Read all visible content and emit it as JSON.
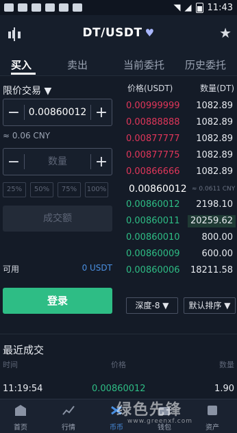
{
  "status_bar": {
    "time": "11:43"
  },
  "header": {
    "pair": "DT/USDT",
    "fav_icon": "heart-icon"
  },
  "tabs": [
    "买入",
    "卖出",
    "当前委托",
    "历史委托"
  ],
  "order_form": {
    "order_type": "限价交易 ▼",
    "price": "0.00860012",
    "approx": "≈ 0.06 CNY",
    "quantity_placeholder": "数量",
    "percentages": [
      "25%",
      "50%",
      "75%",
      "100%"
    ],
    "amount_placeholder": "成交额",
    "available_label": "可用",
    "available_value": "0 USDT",
    "buy_button": "登录"
  },
  "order_book": {
    "price_header": "价格(USDT)",
    "qty_header": "数量(DT)",
    "asks": [
      {
        "price": "0.00999999",
        "qty": "1082.89"
      },
      {
        "price": "0.00888888",
        "qty": "1082.89"
      },
      {
        "price": "0.00877777",
        "qty": "1082.89"
      },
      {
        "price": "0.00877775",
        "qty": "1082.89"
      },
      {
        "price": "0.00866666",
        "qty": "1082.89"
      }
    ],
    "last_price": "0.00860012",
    "last_cny": "≈ 0.0611 CNY",
    "bids": [
      {
        "price": "0.00860012",
        "qty": "2198.10"
      },
      {
        "price": "0.00860011",
        "qty": "20259.62"
      },
      {
        "price": "0.00860010",
        "qty": "800.00"
      },
      {
        "price": "0.00860009",
        "qty": "600.00"
      },
      {
        "price": "0.00860006",
        "qty": "18211.58"
      }
    ],
    "depth": "深度-8 ▼",
    "sort": "默认排序 ▼"
  },
  "recent_trades": {
    "title": "最近成交",
    "headers": [
      "时间",
      "价格",
      "数量"
    ],
    "row": {
      "time": "11:19:54",
      "price": "0.00860012",
      "qty": "1.90"
    }
  },
  "bottom_nav": [
    "首页",
    "行情",
    "币币",
    "钱包",
    "资产"
  ],
  "watermark": {
    "main": "绿色先锋",
    "sub": "www.greenxf.com"
  }
}
